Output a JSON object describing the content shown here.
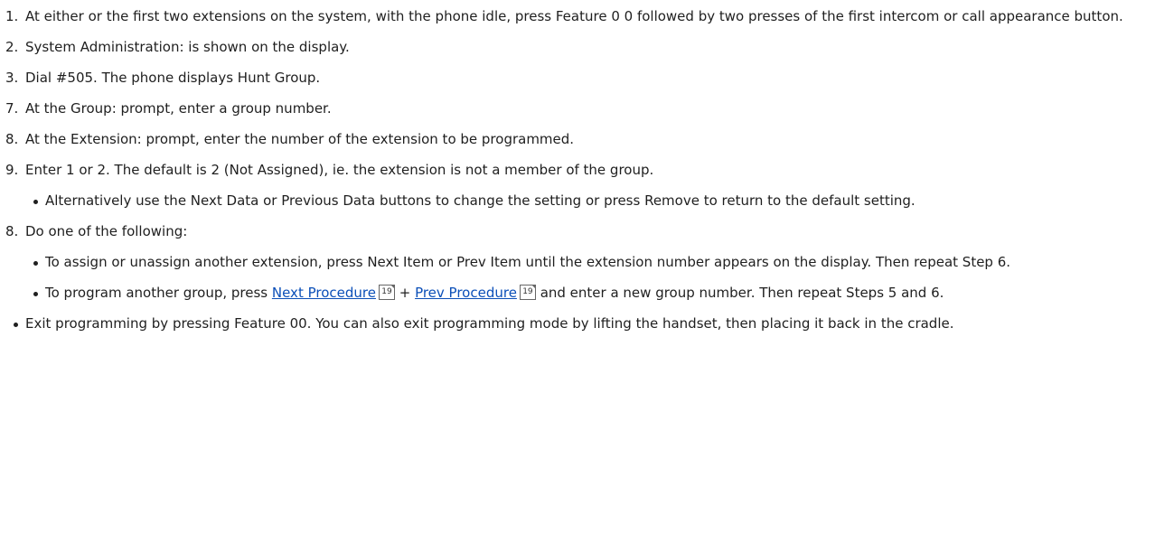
{
  "steps": [
    {
      "num": "1.",
      "text": "At either or the first two extensions on the system, with the phone idle, press Feature 0 0 followed by two presses of the first intercom or call appearance button."
    },
    {
      "num": "2.",
      "text": "System Administration: is shown on the display."
    },
    {
      "num": "3.",
      "text": "Dial #505. The phone displays Hunt Group."
    },
    {
      "num": "7.",
      "text": "At the Group: prompt, enter a group number."
    },
    {
      "num": "8.",
      "text": "At the Extension: prompt, enter the number of the extension to be programmed."
    },
    {
      "num": "9.",
      "text": "Enter 1 or 2. The default is 2 (Not Assigned), ie. the extension is not a member of the group.",
      "bullets": [
        "Alternatively use the Next Data or Previous Data buttons to change the setting or press Remove to return to the default setting."
      ]
    },
    {
      "num": "8.",
      "text": "Do one of the following:",
      "bullet1": "To assign or unassign another extension, press Next Item or Prev Item until the extension number appears on the display. Then repeat Step 6.",
      "bullet2": {
        "before": "To program another group, press ",
        "link1": "Next Procedure",
        "ref1": "19",
        "plus": " + ",
        "link2": "Prev Procedure",
        "ref2": "19",
        "after": " and enter a new group number. Then repeat Steps 5 and 6."
      }
    }
  ],
  "final_bullet": "Exit programming by pressing Feature 00. You can also exit programming mode by lifting the handset, then placing it back in the cradle."
}
